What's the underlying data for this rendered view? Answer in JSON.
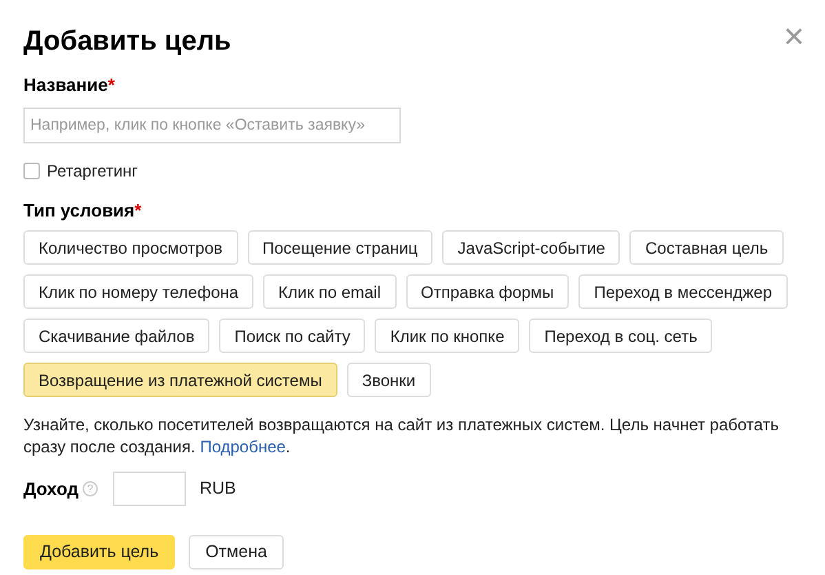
{
  "dialog": {
    "title": "Добавить цель",
    "close": "×"
  },
  "name_field": {
    "label": "Название",
    "required_mark": "*",
    "placeholder": "Например, клик по кнопке «Оставить заявку»"
  },
  "retargeting": {
    "label": "Ретаргетинг",
    "checked": false
  },
  "condition_type": {
    "label": "Тип условия",
    "required_mark": "*",
    "options": [
      [
        {
          "label": "Количество просмотров",
          "selected": false
        },
        {
          "label": "Посещение страниц",
          "selected": false
        },
        {
          "label": "JavaScript-событие",
          "selected": false
        },
        {
          "label": "Составная цель",
          "selected": false
        }
      ],
      [
        {
          "label": "Клик по номеру телефона",
          "selected": false
        },
        {
          "label": "Клик по email",
          "selected": false
        },
        {
          "label": "Отправка формы",
          "selected": false
        },
        {
          "label": "Переход в мессенджер",
          "selected": false
        }
      ],
      [
        {
          "label": "Скачивание файлов",
          "selected": false
        },
        {
          "label": "Поиск по сайту",
          "selected": false
        },
        {
          "label": "Клик по кнопке",
          "selected": false
        },
        {
          "label": "Переход в соц. сеть",
          "selected": false
        }
      ],
      [
        {
          "label": "Возвращение из платежной системы",
          "selected": true
        },
        {
          "label": "Звонки",
          "selected": false
        }
      ]
    ]
  },
  "description": {
    "text": "Узнайте, сколько посетителей возвращаются на сайт из платежных систем. Цель начнет работать сразу после создания. ",
    "link": "Подробнее",
    "after": "."
  },
  "income": {
    "label": "Доход",
    "help": "?",
    "currency": "RUB"
  },
  "buttons": [
    {
      "label": "Добавить цель",
      "kind": "primary"
    },
    {
      "label": "Отмена",
      "kind": "secondary"
    }
  ]
}
